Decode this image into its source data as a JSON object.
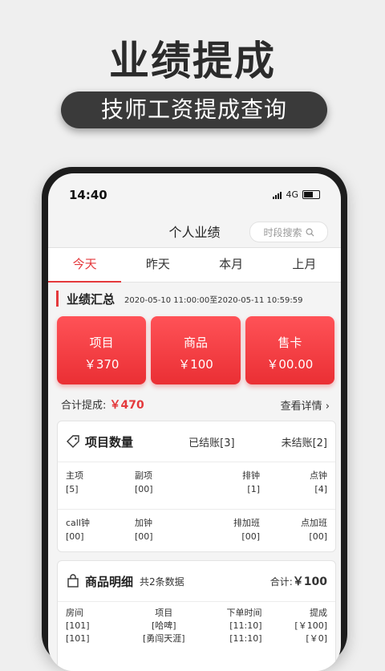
{
  "promo": {
    "headline": "业绩提成",
    "subtitle": "技师工资提成查询"
  },
  "status": {
    "time": "14:40",
    "network": "4G"
  },
  "nav": {
    "title": "个人业绩",
    "search_placeholder": "时段搜索"
  },
  "tabs": [
    {
      "label": "今天",
      "active": true
    },
    {
      "label": "昨天",
      "active": false
    },
    {
      "label": "本月",
      "active": false
    },
    {
      "label": "上月",
      "active": false
    }
  ],
  "summary": {
    "title": "业绩汇总",
    "range": "2020-05-10 11:00:00至2020-05-11 10:59:59"
  },
  "cards": [
    {
      "label": "项目",
      "value": "￥370"
    },
    {
      "label": "商品",
      "value": "￥100"
    },
    {
      "label": "售卡",
      "value": "￥00.00"
    }
  ],
  "total": {
    "label": "合计提成:",
    "amount": "￥470",
    "detail_link": "查看详情"
  },
  "project_panel": {
    "title": "项目数量",
    "settled": "已结账[3]",
    "unsettled": "未结账[2]",
    "rows": [
      [
        {
          "label": "主项",
          "value": "[5]"
        },
        {
          "label": "副项",
          "value": "[00]"
        },
        {
          "label": "排钟",
          "value": "[1]"
        },
        {
          "label": "点钟",
          "value": "[4]"
        }
      ],
      [
        {
          "label": "call钟",
          "value": "[00]"
        },
        {
          "label": "加钟",
          "value": "[00]"
        },
        {
          "label": "排加班",
          "value": "[00]"
        },
        {
          "label": "点加班",
          "value": "[00]"
        }
      ]
    ]
  },
  "goods_panel": {
    "title": "商品明细",
    "count_text": "共2条数据",
    "total_label": "合计:",
    "total_value": "￥100",
    "columns": [
      "房间",
      "项目",
      "下单时间",
      "提成"
    ],
    "rows": [
      [
        "[101]",
        "[哈啤]",
        "[11:10]",
        "[￥100]"
      ],
      [
        "[101]",
        "[勇闯天涯]",
        "[11:10]",
        "[￥0]"
      ]
    ]
  },
  "colors": {
    "accent": "#e4393c",
    "dark": "#3a3a3a"
  }
}
